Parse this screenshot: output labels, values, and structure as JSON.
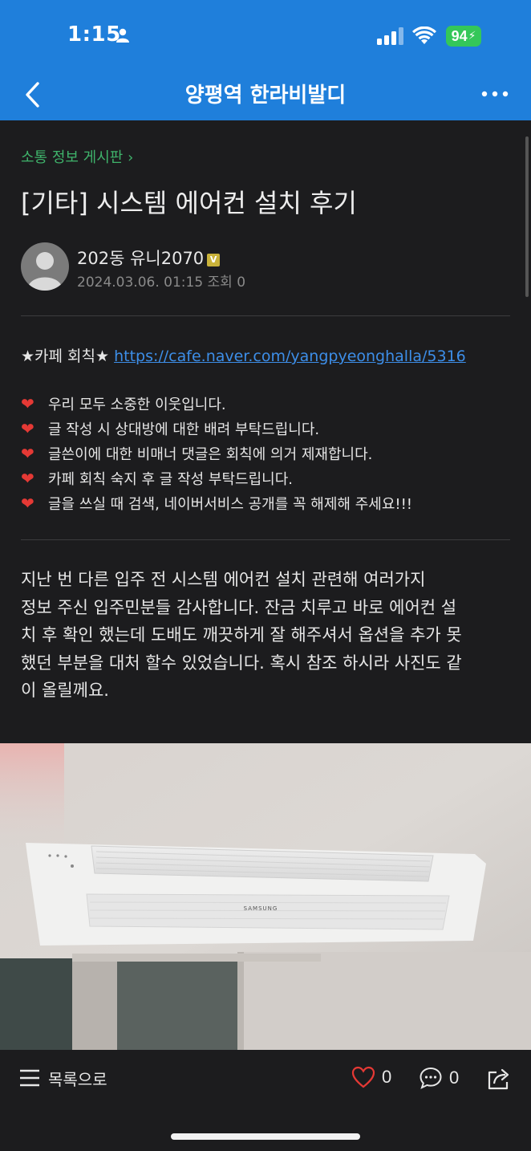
{
  "status_bar": {
    "time": "1:15",
    "battery": "94"
  },
  "nav": {
    "title": "양평역 한라비발디"
  },
  "post": {
    "board": "소통 정보 게시판 ›",
    "title": "[기타] 시스템 에어컨 설치 후기",
    "author": "202동 유니2070",
    "author_badge": "V",
    "meta": "2024.03.06. 01:15  조회 0",
    "rules_prefix": "★카페 회칙★ ",
    "rules_link": "https://cafe.naver.com/yangpyeonghalla/5316",
    "rules": [
      "우리 모두 소중한 이웃입니다.",
      "글 작성 시 상대방에 대한 배려 부탁드립니다.",
      "글쓴이에 대한 비매너 댓글은 회칙에 의거 제재합니다.",
      "카페 회칙 숙지 후 글 작성 부탁드립니다.",
      "글을 쓰실 때 검색, 네이버서비스 공개를 꼭 해제해 주세요!!!"
    ],
    "body_lines": [
      "지난 번 다른 입주 전 시스템 에어컨 설치 관련해 여러가지",
      "정보 주신 입주민분들 감사합니다.  잔금 치루고 바로 에어컨 설",
      "치 후 확인 했는데 도배도 깨끗하게 잘 해주셔서 옵션을 추가 못",
      "했던 부분을 대처 할수 있었습니다. 혹시 참조 하시라 사진도 같",
      "이 올릴께요."
    ],
    "photo_brand": "SAMSUNG"
  },
  "bottom_bar": {
    "list_label": "목록으로",
    "likes": "0",
    "comments": "0"
  },
  "colors": {
    "header": "#1f7fdb",
    "background": "#1c1c1e",
    "board_link": "#3fb36b",
    "link": "#3d8ee8",
    "heart": "#e53935"
  }
}
